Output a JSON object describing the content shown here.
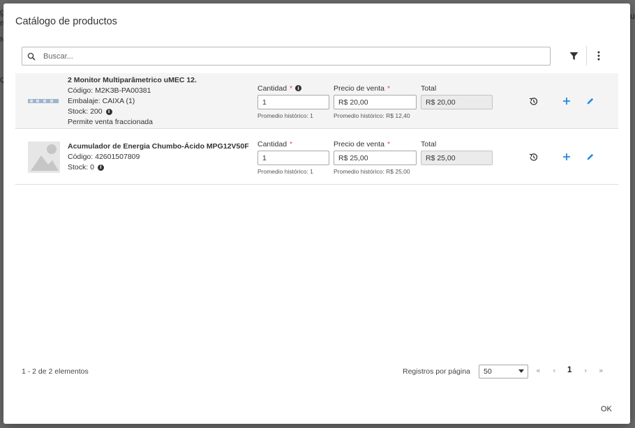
{
  "dialog": {
    "title": "Catálogo de productos"
  },
  "search": {
    "placeholder": "Buscar...",
    "value": ""
  },
  "labels": {
    "quantity": "Cantidad",
    "price": "Precio de venta",
    "total": "Total",
    "required_mark": "*"
  },
  "products": [
    {
      "name": "2 Monitor Multiparâmetrico uMEC 12.",
      "code": "Código: M2K3B-PA00381",
      "packaging": "Embalaje: CAIXA (1)",
      "stock": "Stock: 200",
      "note": "Permite venta fraccionada",
      "quantity": "1",
      "price": "R$ 20,00",
      "total": "R$ 20,00",
      "qty_hint": "Promedio histórico: 1",
      "price_hint": "Promedio histórico: R$ 12,40"
    },
    {
      "name": "Acumulador de Energia Chumbo-Ácido MPG12V50F",
      "code": "Código: 42601507809",
      "stock": "Stock: 0",
      "quantity": "1",
      "price": "R$ 25,00",
      "total": "R$ 25,00",
      "qty_hint": "Promedio histórico: 1",
      "price_hint": "Promedio histórico: R$ 25,00"
    }
  ],
  "footer": {
    "count": "1 - 2 de 2 elementos",
    "per_page_label": "Registros por página",
    "per_page_value": "50",
    "first": "«",
    "prev": "‹",
    "page": "1",
    "next": "›",
    "last": "»",
    "ok": "OK"
  },
  "background": {
    "frag1": "g",
    "frag2": "m",
    "frag3": "N",
    "frag4": "Q",
    "frag5": "u"
  },
  "colors": {
    "accent": "#1e88e5",
    "required": "#d9534f",
    "row_alt": "#f4f4f4"
  }
}
